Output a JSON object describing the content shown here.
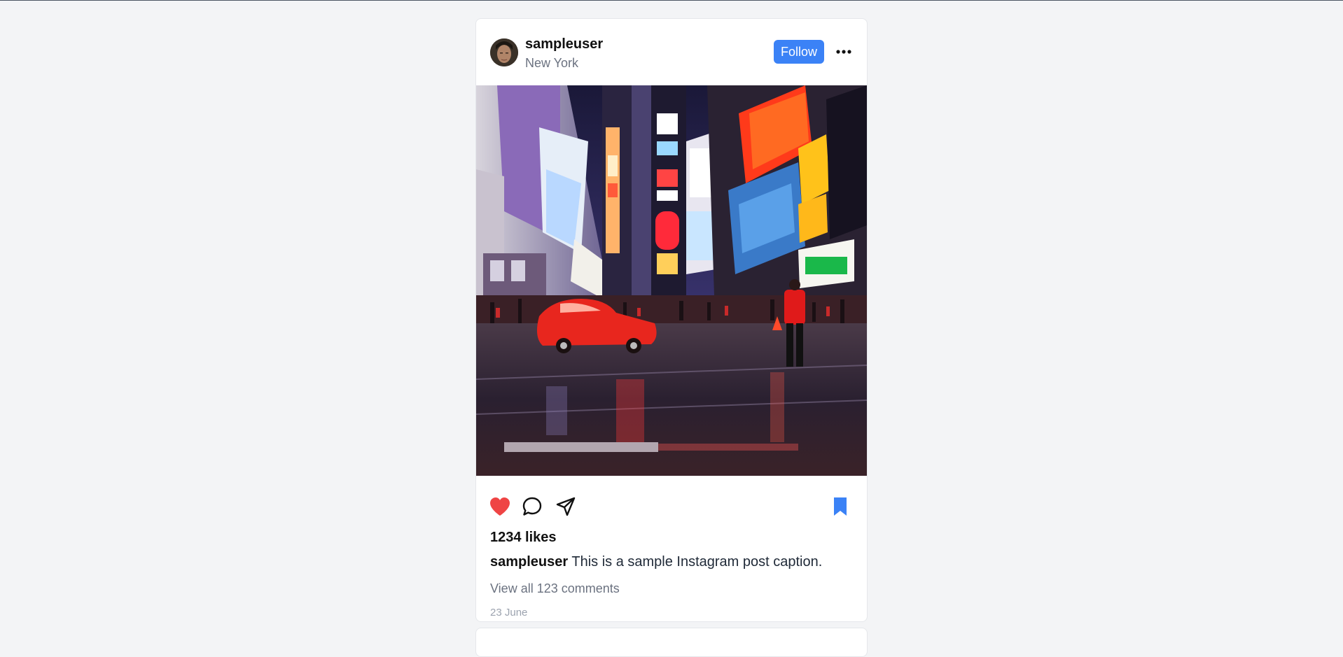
{
  "post": {
    "username": "sampleuser",
    "location": "New York",
    "follow_label": "Follow",
    "likes_text": "1234 likes",
    "caption_user": "sampleuser",
    "caption_text": " This is a sample Instagram post caption.",
    "view_comments": "View all 123 comments",
    "date": "23 June",
    "liked": true,
    "saved": true
  },
  "icons": {
    "more": "more-options-icon",
    "like": "heart-icon",
    "comment": "comment-icon",
    "share": "share-icon",
    "save": "bookmark-icon"
  },
  "colors": {
    "accent": "#3b82f6",
    "like": "#ef4444",
    "background": "#f3f4f6"
  }
}
